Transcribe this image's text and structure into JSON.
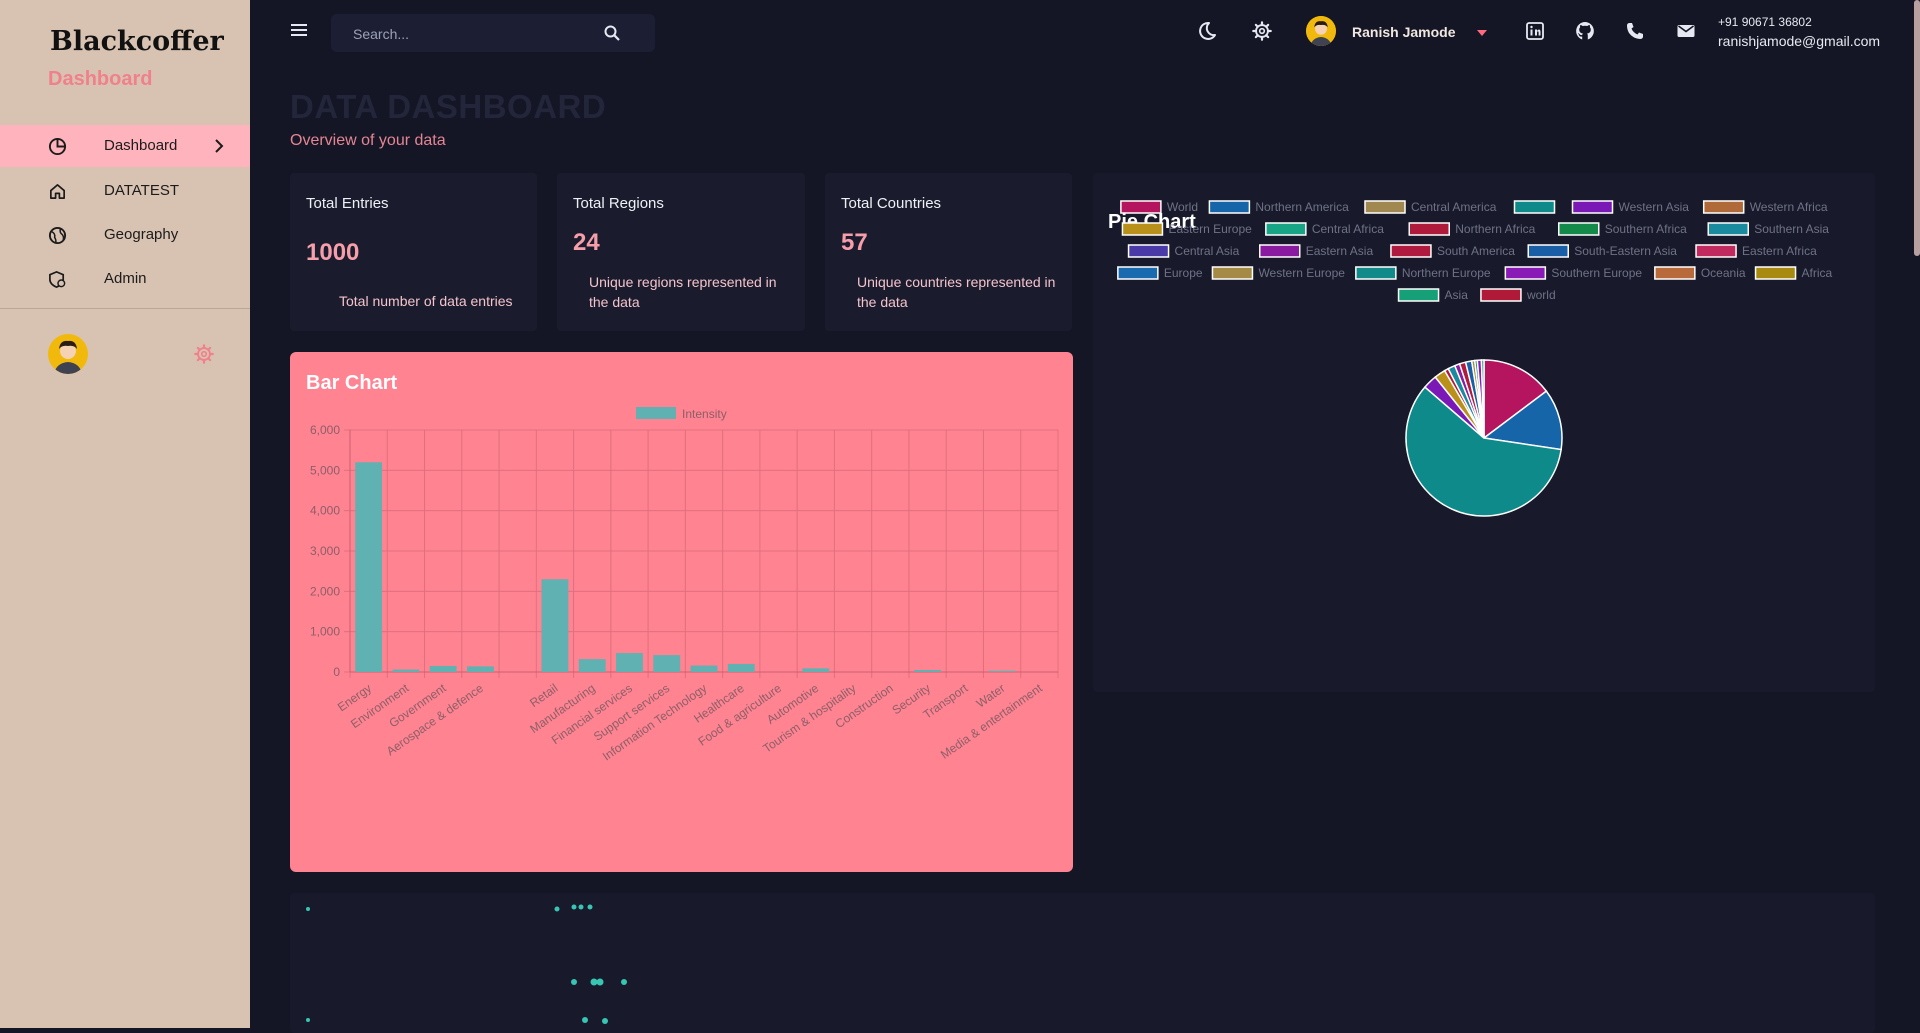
{
  "sidebar": {
    "brand": "Blackcoffer",
    "section_title": "Dashboard",
    "items": [
      {
        "label": "Dashboard",
        "icon": "pie-chart-icon",
        "active": true
      },
      {
        "label": "DATATEST",
        "icon": "home-icon",
        "active": false
      },
      {
        "label": "Geography",
        "icon": "globe-icon",
        "active": false
      },
      {
        "label": "Admin",
        "icon": "admin-shield-icon",
        "active": false
      }
    ]
  },
  "topbar": {
    "search_placeholder": "Search...",
    "user_name": "Ranish Jamode",
    "phone": "+91 90671 36802",
    "email": "ranishjamode@gmail.com"
  },
  "header": {
    "title": "DATA DASHBOARD",
    "subtitle": "Overview of your data"
  },
  "stats": [
    {
      "title": "Total Entries",
      "value": "1000",
      "description": "Total number of data entries"
    },
    {
      "title": "Total Regions",
      "value": "24",
      "description": "Unique regions represented in the data"
    },
    {
      "title": "Total Countries",
      "value": "57",
      "description": "Unique countries represented in the data"
    }
  ],
  "colors": {
    "accent_pink": "#ff8391",
    "bar_teal": "#5fb2b1",
    "background": "#141625",
    "sidebar": "#d8c3b2"
  },
  "chart_data": [
    {
      "type": "bar",
      "title": "Bar Chart",
      "legend": [
        "Intensity"
      ],
      "legend_position": "top",
      "grid": true,
      "ylim": [
        0,
        6000
      ],
      "yticks": [
        "0",
        "1,000",
        "2,000",
        "3,000",
        "4,000",
        "5,000",
        "6,000"
      ],
      "categories": [
        "Energy",
        "Environment",
        "Government",
        "Aerospace & defence",
        "",
        "Retail",
        "Manufacturing",
        "Financial services",
        "Support services",
        "Information Technology",
        "Healthcare",
        "Food & agriculture",
        "Automotive",
        "Tourism & hospitality",
        "Construction",
        "Security",
        "Transport",
        "Water",
        "Media & entertainment"
      ],
      "series": [
        {
          "name": "Intensity",
          "values": [
            5200,
            60,
            150,
            140,
            0,
            2300,
            320,
            470,
            420,
            160,
            200,
            0,
            90,
            0,
            0,
            50,
            0,
            30,
            0
          ]
        }
      ]
    },
    {
      "type": "pie",
      "title": "Pie Chart",
      "legend_position": "top",
      "labels": [
        "World",
        "Northern America",
        "Central America",
        "",
        "Western Asia",
        "Western Africa",
        "Eastern Europe",
        "Central Africa",
        "Northern Africa",
        "Southern Africa",
        "Southern Asia",
        "Central Asia",
        "Eastern Asia",
        "South America",
        "South-Eastern Asia",
        "Eastern Africa",
        "Europe",
        "Western Europe",
        "Northern Europe",
        "Southern Europe",
        "Oceania",
        "Africa",
        "Asia",
        "world"
      ],
      "colors": [
        "#b5155f",
        "#1565a8",
        "#a08850",
        "#0f8a8a",
        "#7a19b5",
        "#b06a3a",
        "#b8901a",
        "#17a585",
        "#b01a3a",
        "#148a4a",
        "#1a8a9f",
        "#4a3aa8",
        "#8a1a9f",
        "#b01a3f",
        "#1a5fa5",
        "#c02a5f",
        "#1a6ab0",
        "#a58a45",
        "#128a8a",
        "#8a1ab5",
        "#b86a3a",
        "#a88a10",
        "#15a078",
        "#b01a38"
      ],
      "values": [
        140,
        120,
        0,
        560,
        28,
        0,
        22,
        0,
        8,
        0,
        14,
        0,
        10,
        12,
        12,
        0,
        0,
        6,
        5,
        8,
        0,
        0,
        5,
        0
      ]
    }
  ]
}
